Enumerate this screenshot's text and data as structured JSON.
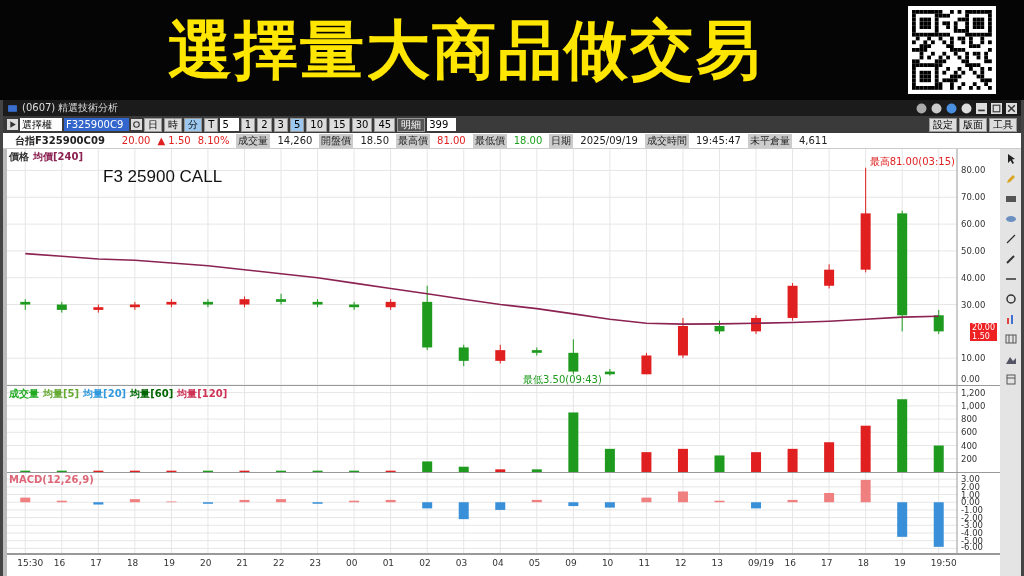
{
  "banner": {
    "title": "選擇量大商品做交易"
  },
  "window": {
    "title": "(0607) 精選技術分析"
  },
  "toolbar": {
    "market": "選擇權",
    "symbol": "F325900C9",
    "periods": [
      {
        "label": "日",
        "selected": false
      },
      {
        "label": "時",
        "selected": false
      },
      {
        "label": "分",
        "selected": true
      },
      {
        "label": "T",
        "selected": false
      }
    ],
    "interval": "5",
    "quick": [
      {
        "label": "1",
        "selected": false
      },
      {
        "label": "2",
        "selected": false
      },
      {
        "label": "3",
        "selected": false
      },
      {
        "label": "5",
        "selected": true
      },
      {
        "label": "10",
        "selected": false
      },
      {
        "label": "15",
        "selected": false
      },
      {
        "label": "30",
        "selected": false
      },
      {
        "label": "45",
        "selected": false
      }
    ],
    "detail_button": "明細",
    "count": "399",
    "right_buttons": [
      "設定",
      "版面",
      "工具"
    ]
  },
  "quote": {
    "symbol": "台指F325900C09",
    "price": "20.00",
    "change": "▲ 1.50",
    "percent": "8.10%",
    "fields": [
      {
        "label": "成交量",
        "value": "14,260",
        "color": "#222222"
      },
      {
        "label": "開盤價",
        "value": "18.50",
        "color": "#222222"
      },
      {
        "label": "最高價",
        "value": "81.00",
        "color": "#e02020"
      },
      {
        "label": "最低價",
        "value": "18.00",
        "color": "#20a020"
      },
      {
        "label": "日期",
        "value": "2025/09/19",
        "color": "#222222"
      },
      {
        "label": "成交時間",
        "value": "19:45:47",
        "color": "#222222"
      },
      {
        "label": "未平倉量",
        "value": "4,611",
        "color": "#222222"
      }
    ]
  },
  "price_panel": {
    "legend": "價格",
    "overlay_text": "F3 25900 CALL",
    "price_tag": [
      "20.00",
      "1.50"
    ],
    "chart_data": {
      "type": "candlestick",
      "grid": true,
      "ohlc": [
        [
          31,
          32,
          28,
          30
        ],
        [
          30,
          31,
          27,
          28
        ],
        [
          28,
          30,
          27,
          29
        ],
        [
          29,
          31,
          28,
          30
        ],
        [
          30,
          32,
          29,
          31
        ],
        [
          31,
          32,
          29,
          30
        ],
        [
          30,
          33,
          29,
          32
        ],
        [
          32,
          34,
          30,
          31
        ],
        [
          31,
          32,
          29,
          30
        ],
        [
          30,
          31,
          28,
          29
        ],
        [
          29,
          32,
          28,
          31
        ],
        [
          31,
          37,
          13,
          14
        ],
        [
          14,
          15,
          7,
          9
        ],
        [
          9,
          15,
          8,
          13
        ],
        [
          13,
          14,
          11,
          12
        ],
        [
          12,
          17,
          4,
          5
        ],
        [
          5,
          6,
          3.5,
          4
        ],
        [
          4,
          12,
          4,
          11
        ],
        [
          11,
          25,
          10,
          22
        ],
        [
          22,
          24,
          19,
          20
        ],
        [
          20,
          26,
          19,
          25
        ],
        [
          25,
          38,
          24,
          37
        ],
        [
          37,
          45,
          36,
          43
        ],
        [
          43,
          81,
          42,
          64
        ],
        [
          64,
          65,
          20,
          26
        ],
        [
          26,
          28,
          19,
          20
        ]
      ],
      "series": [
        {
          "name": "均價[240]",
          "type": "line",
          "color": "#8b2252",
          "values": [
            49,
            48,
            47,
            46.5,
            45.5,
            44.5,
            43,
            41.5,
            40,
            38,
            36,
            34,
            32,
            30,
            28.5,
            26.5,
            24.5,
            23,
            22.7,
            22.8,
            23,
            23.3,
            23.8,
            24.5,
            25.3,
            25.6
          ]
        }
      ],
      "ylim": [
        0,
        88
      ],
      "yticks": [
        {
          "value": 0,
          "label": "0.00"
        },
        {
          "value": 10,
          "label": "10.00"
        },
        {
          "value": 30,
          "label": "30.00"
        },
        {
          "value": 40,
          "label": "40.00"
        },
        {
          "value": 50,
          "label": "50.00"
        },
        {
          "value": 60,
          "label": "60.00"
        },
        {
          "value": 70,
          "label": "70.00"
        },
        {
          "value": 80,
          "label": "80.00"
        }
      ],
      "annotations": [
        "最高81.00(03:15)",
        "最低3.50(09:43)"
      ]
    }
  },
  "volume_panel": {
    "legend": [
      {
        "text": "成交量",
        "color": "#22aa22"
      },
      {
        "text": "均量[5]",
        "color": "#66aa33"
      },
      {
        "text": "均量[20]",
        "color": "#3399dd"
      },
      {
        "text": "均量[60]",
        "color": "#006600"
      },
      {
        "text": "均量[120]",
        "color": "#cc3355"
      }
    ],
    "chart_data": {
      "type": "bar",
      "grid": true,
      "values": [
        20,
        20,
        20,
        20,
        20,
        20,
        20,
        20,
        20,
        20,
        20,
        160,
        80,
        40,
        40,
        900,
        350,
        300,
        350,
        250,
        300,
        350,
        450,
        700,
        1100,
        400
      ],
      "ylim": [
        0,
        1300
      ],
      "yticks": [
        {
          "value": 200,
          "label": "200"
        },
        {
          "value": 400,
          "label": "400"
        },
        {
          "value": 600,
          "label": "600"
        },
        {
          "value": 800,
          "label": "800"
        },
        {
          "value": 1000,
          "label": "1,000"
        },
        {
          "value": 1200,
          "label": "1,200"
        }
      ]
    }
  },
  "macd_panel": {
    "legend": [
      {
        "text": "MACD(12,26,9)",
        "color": "#dd6677"
      }
    ],
    "chart_data": {
      "type": "bar",
      "grid": true,
      "categories": [
        "15:30",
        "16",
        "17",
        "18",
        "19",
        "20",
        "21",
        "22",
        "23",
        "00",
        "01",
        "02",
        "03",
        "04",
        "05",
        "09",
        "10",
        "11",
        "12",
        "13",
        "09/19",
        "16",
        "17",
        "18",
        "19",
        "19:50"
      ],
      "values": [
        0.6,
        0.2,
        -0.3,
        0.4,
        0.1,
        -0.2,
        0.3,
        0.4,
        -0.2,
        0.2,
        0.3,
        -0.8,
        -2.2,
        -1,
        0.3,
        -0.5,
        -0.7,
        0.6,
        1.4,
        0.2,
        -0.8,
        0.3,
        1.2,
        2.9,
        -4.5,
        -5.8
      ],
      "ylim": [
        -6.6,
        3.8
      ],
      "yticks": [
        {
          "value": 3,
          "label": "3.00"
        },
        {
          "value": 2,
          "label": "2.00"
        },
        {
          "value": 1,
          "label": "1.00"
        },
        {
          "value": 0,
          "label": "0.00"
        },
        {
          "value": -1,
          "label": "-1.00"
        },
        {
          "value": -2,
          "label": "-2.00"
        },
        {
          "value": -3,
          "label": "-3.00"
        },
        {
          "value": -4,
          "label": "-4.00"
        },
        {
          "value": -5,
          "label": "-5.00"
        },
        {
          "value": -6,
          "label": "-6.00"
        }
      ]
    }
  }
}
